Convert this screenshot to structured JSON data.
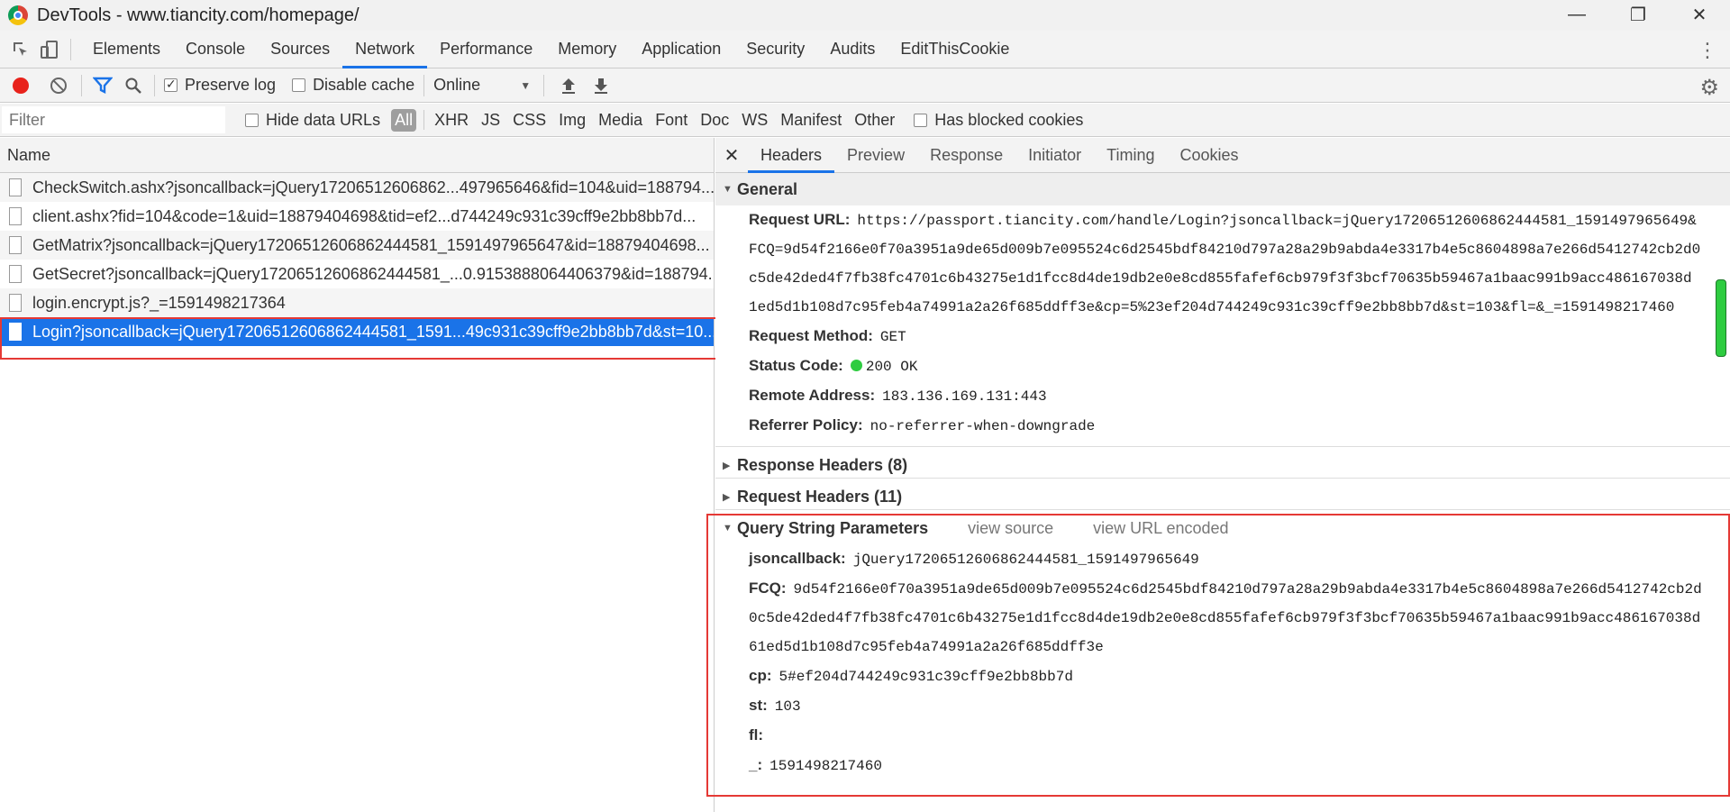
{
  "window": {
    "title": "DevTools - www.tiancity.com/homepage/",
    "minimize_icon": "minimize-icon",
    "maximize_icon": "maximize-icon",
    "close_icon": "close-icon"
  },
  "tabs": [
    "Elements",
    "Console",
    "Sources",
    "Network",
    "Performance",
    "Memory",
    "Application",
    "Security",
    "Audits",
    "EditThisCookie"
  ],
  "active_tab": "Network",
  "toolbar": {
    "preserve_log_label": "Preserve log",
    "preserve_log_checked": true,
    "disable_cache_label": "Disable cache",
    "disable_cache_checked": false,
    "throttling_value": "Online"
  },
  "filter": {
    "placeholder": "Filter",
    "hide_data_urls_label": "Hide data URLs",
    "types": [
      "All",
      "XHR",
      "JS",
      "CSS",
      "Img",
      "Media",
      "Font",
      "Doc",
      "WS",
      "Manifest",
      "Other"
    ],
    "has_blocked_cookies_label": "Has blocked cookies"
  },
  "requests": {
    "column_header": "Name",
    "items": [
      "CheckSwitch.ashx?jsoncallback=jQuery17206512606862...497965646&fid=104&uid=188794...",
      "client.ashx?fid=104&code=1&uid=18879404698&tid=ef2...d744249c931c39cff9e2bb8bb7d...",
      "GetMatrix?jsoncallback=jQuery17206512606862444581_1591497965647&id=18879404698...",
      "GetSecret?jsoncallback=jQuery17206512606862444581_...0.9153888064406379&id=188794...",
      "login.encrypt.js?_=1591498217364",
      "Login?jsoncallback=jQuery17206512606862444581_1591...49c931c39cff9e2bb8bb7d&st=10..."
    ]
  },
  "detail": {
    "tabs": [
      "Headers",
      "Preview",
      "Response",
      "Initiator",
      "Timing",
      "Cookies"
    ],
    "active_tab": "Headers",
    "general": {
      "title": "General",
      "request_url_label": "Request URL:",
      "request_url_lines": [
        "https://passport.tiancity.com/handle/Login?jsoncallback=jQuery17206512606862444581_1591497965649&",
        "FCQ=9d54f2166e0f70a3951a9de65d009b7e095524c6d2545bdf84210d797a28a29b9abda4e3317b4e5c8604898a7e266d5412742cb2d0",
        "c5de42ded4f7fb38fc4701c6b43275e1d1fcc8d4de19db2e0e8cd855fafef6cb979f3f3bcf70635b59467a1baac991b9acc486167038d",
        "1ed5d1b108d7c95feb4a74991a2a26f685ddff3e&cp=5%23ef204d744249c931c39cff9e2bb8bb7d&st=103&fl=&_=1591498217460"
      ],
      "request_method_label": "Request Method:",
      "request_method": "GET",
      "status_code_label": "Status Code:",
      "status_code": "200 OK",
      "remote_address_label": "Remote Address:",
      "remote_address": "183.136.169.131:443",
      "referrer_policy_label": "Referrer Policy:",
      "referrer_policy": "no-referrer-when-downgrade"
    },
    "response_headers": "Response Headers (8)",
    "request_headers": "Request Headers (11)",
    "query": {
      "title": "Query String Parameters",
      "view_source": "view source",
      "view_url_encoded": "view URL encoded",
      "params": {
        "jsoncallback_key": "jsoncallback:",
        "jsoncallback_val": "jQuery17206512606862444581_1591497965649",
        "fcq_key": "FCQ:",
        "fcq_lines": [
          "9d54f2166e0f70a3951a9de65d009b7e095524c6d2545bdf84210d797a28a29b9abda4e3317b4e5c8604898a7e266d5412742cb2d",
          "0c5de42ded4f7fb38fc4701c6b43275e1d1fcc8d4de19db2e0e8cd855fafef6cb979f3f3bcf70635b59467a1baac991b9acc486167038d",
          "61ed5d1b108d7c95feb4a74991a2a26f685ddff3e"
        ],
        "cp_key": "cp:",
        "cp_val": "5#ef204d744249c931c39cff9e2bb8bb7d",
        "st_key": "st:",
        "st_val": "103",
        "fl_key": "fl:",
        "fl_val": "",
        "underscore_key": "_:",
        "underscore_val": "1591498217460"
      }
    }
  },
  "colors": {
    "accent": "#1a73e8",
    "highlight_box": "#e53935",
    "record": "#e8221b",
    "status_ok": "#2ecc40"
  }
}
